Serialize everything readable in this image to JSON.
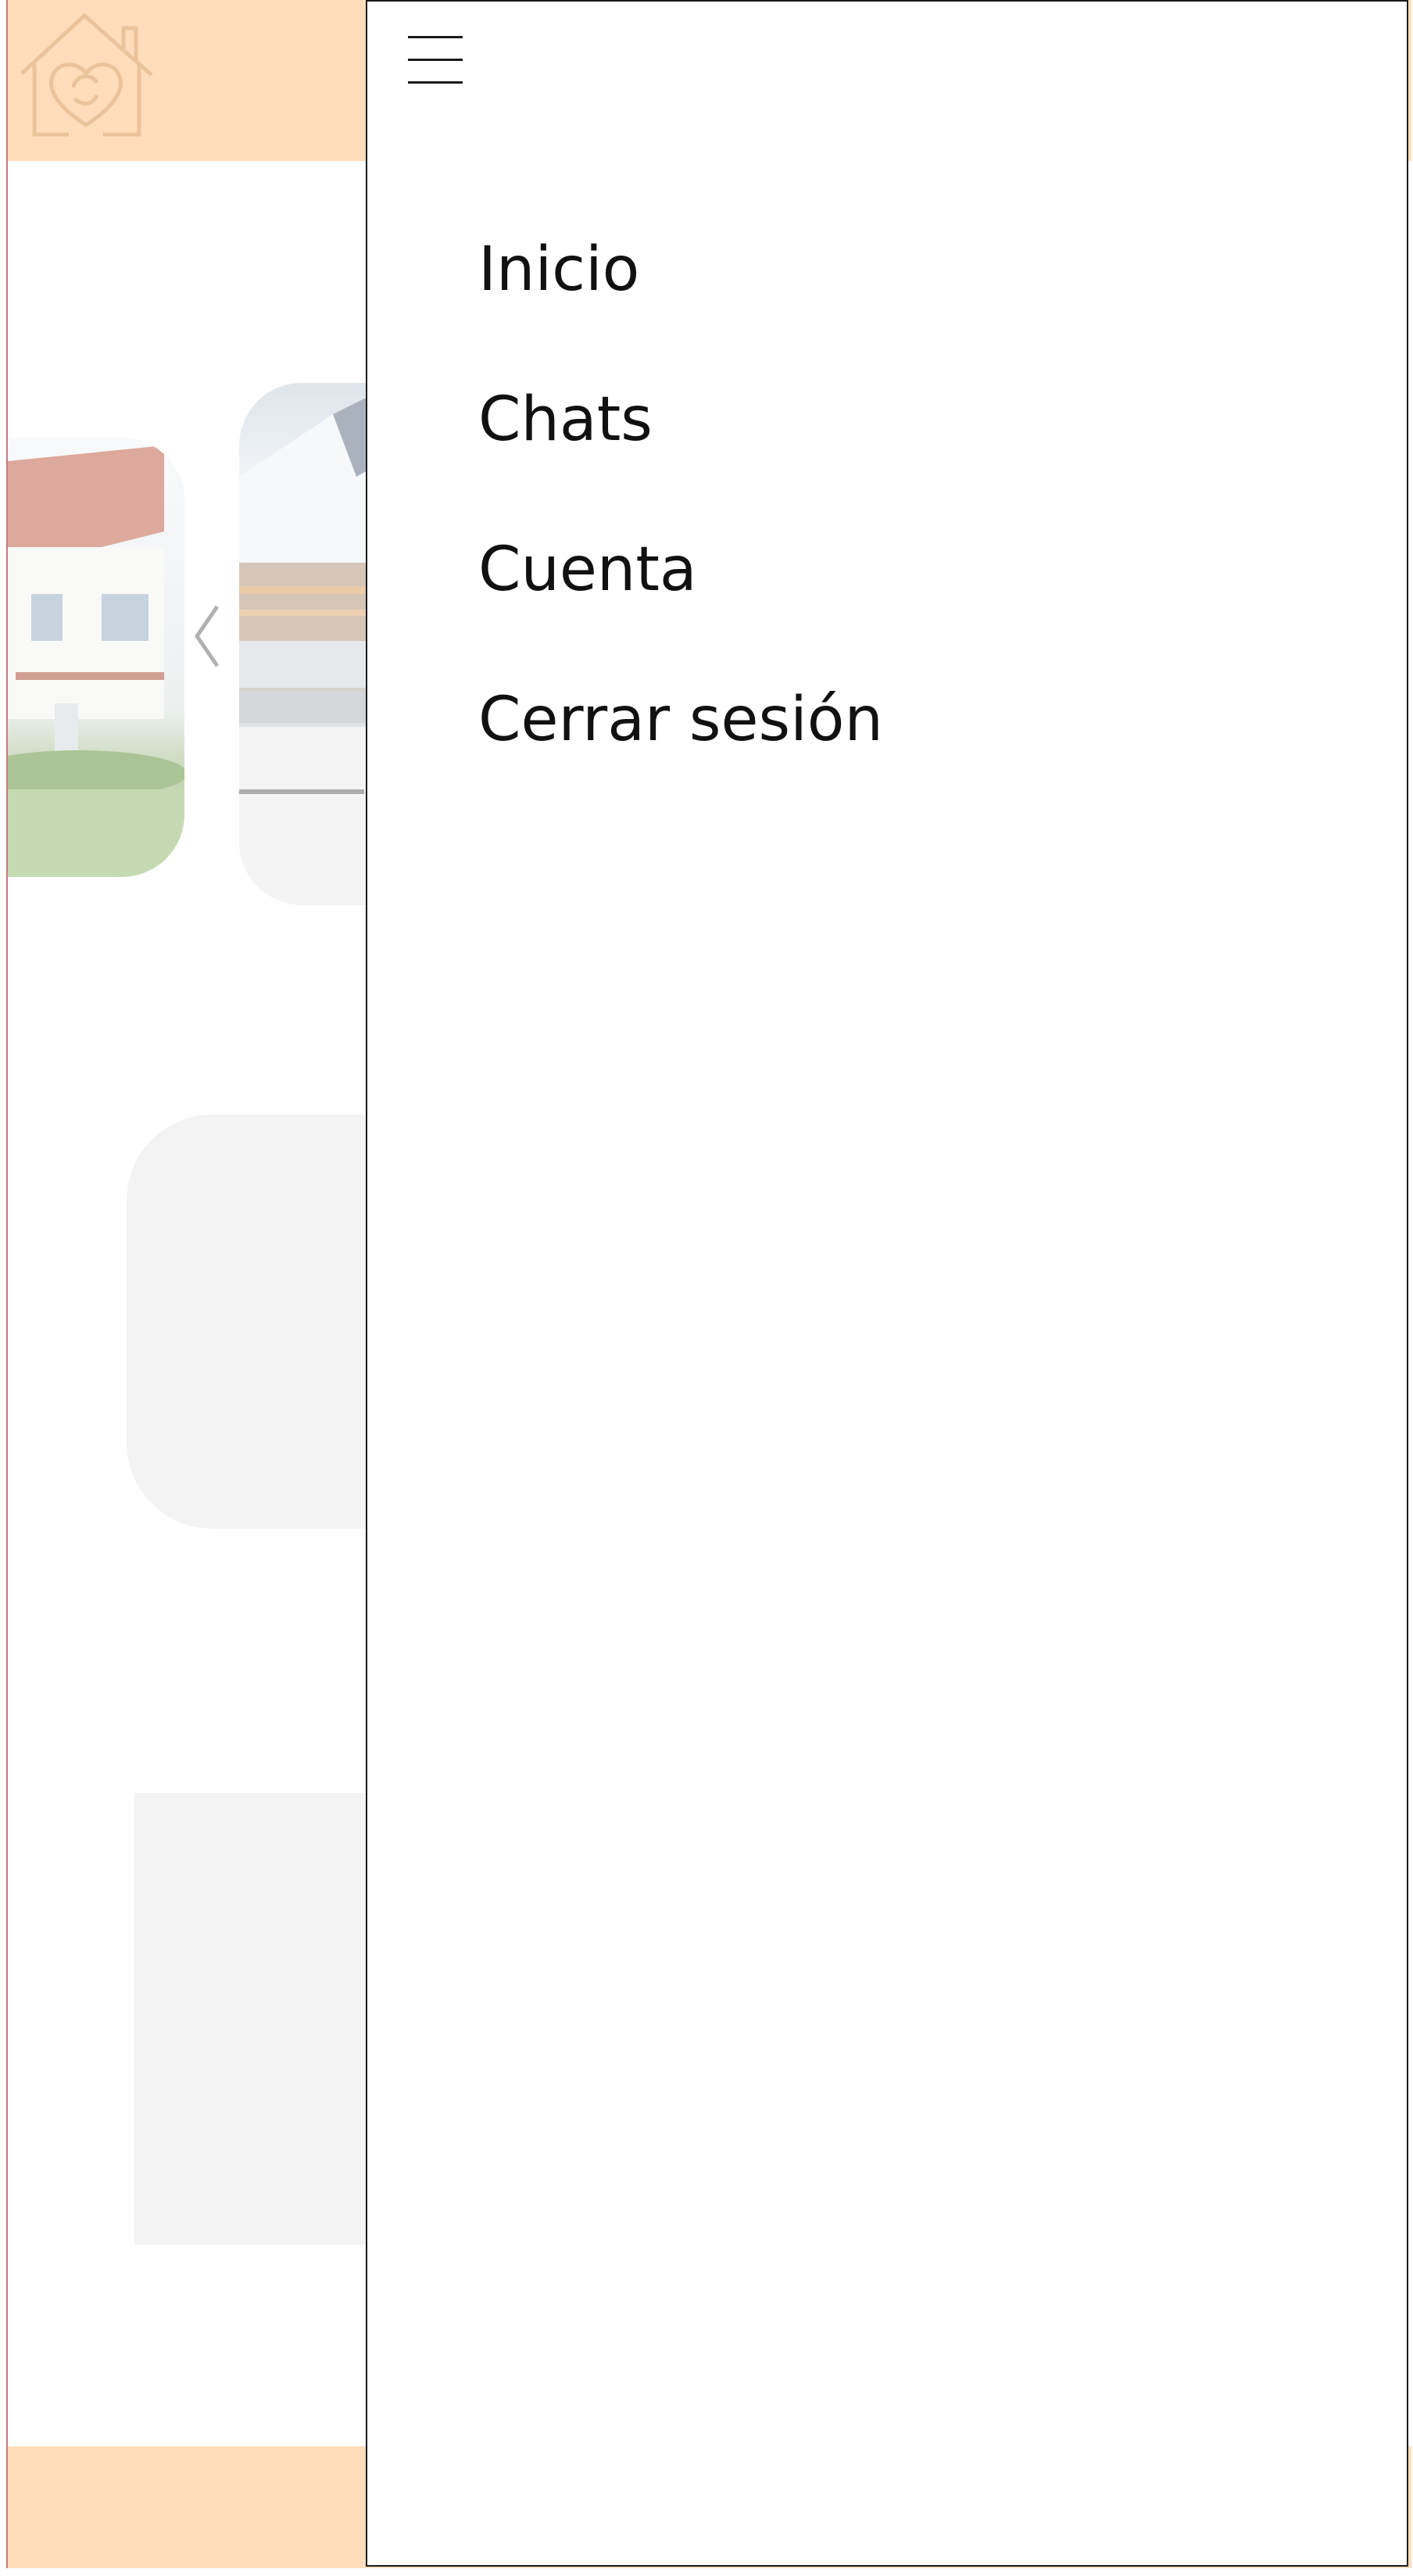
{
  "app": {
    "logo_icon": "house-heart-refresh-icon",
    "colors": {
      "header": "#ffc489",
      "logo": "#e0a060",
      "drawer_border": "#1a1a1a",
      "placeholder": "#ebebeb"
    }
  },
  "carousel": {
    "prev_icon": "chevron-left-icon",
    "images": [
      "house-photo",
      "snowy-mountain-town-photo"
    ]
  },
  "drawer": {
    "toggle_icon": "hamburger-menu-icon",
    "items": [
      {
        "label": "Inicio"
      },
      {
        "label": "Chats"
      },
      {
        "label": "Cuenta"
      },
      {
        "label": "Cerrar sesión"
      }
    ]
  }
}
